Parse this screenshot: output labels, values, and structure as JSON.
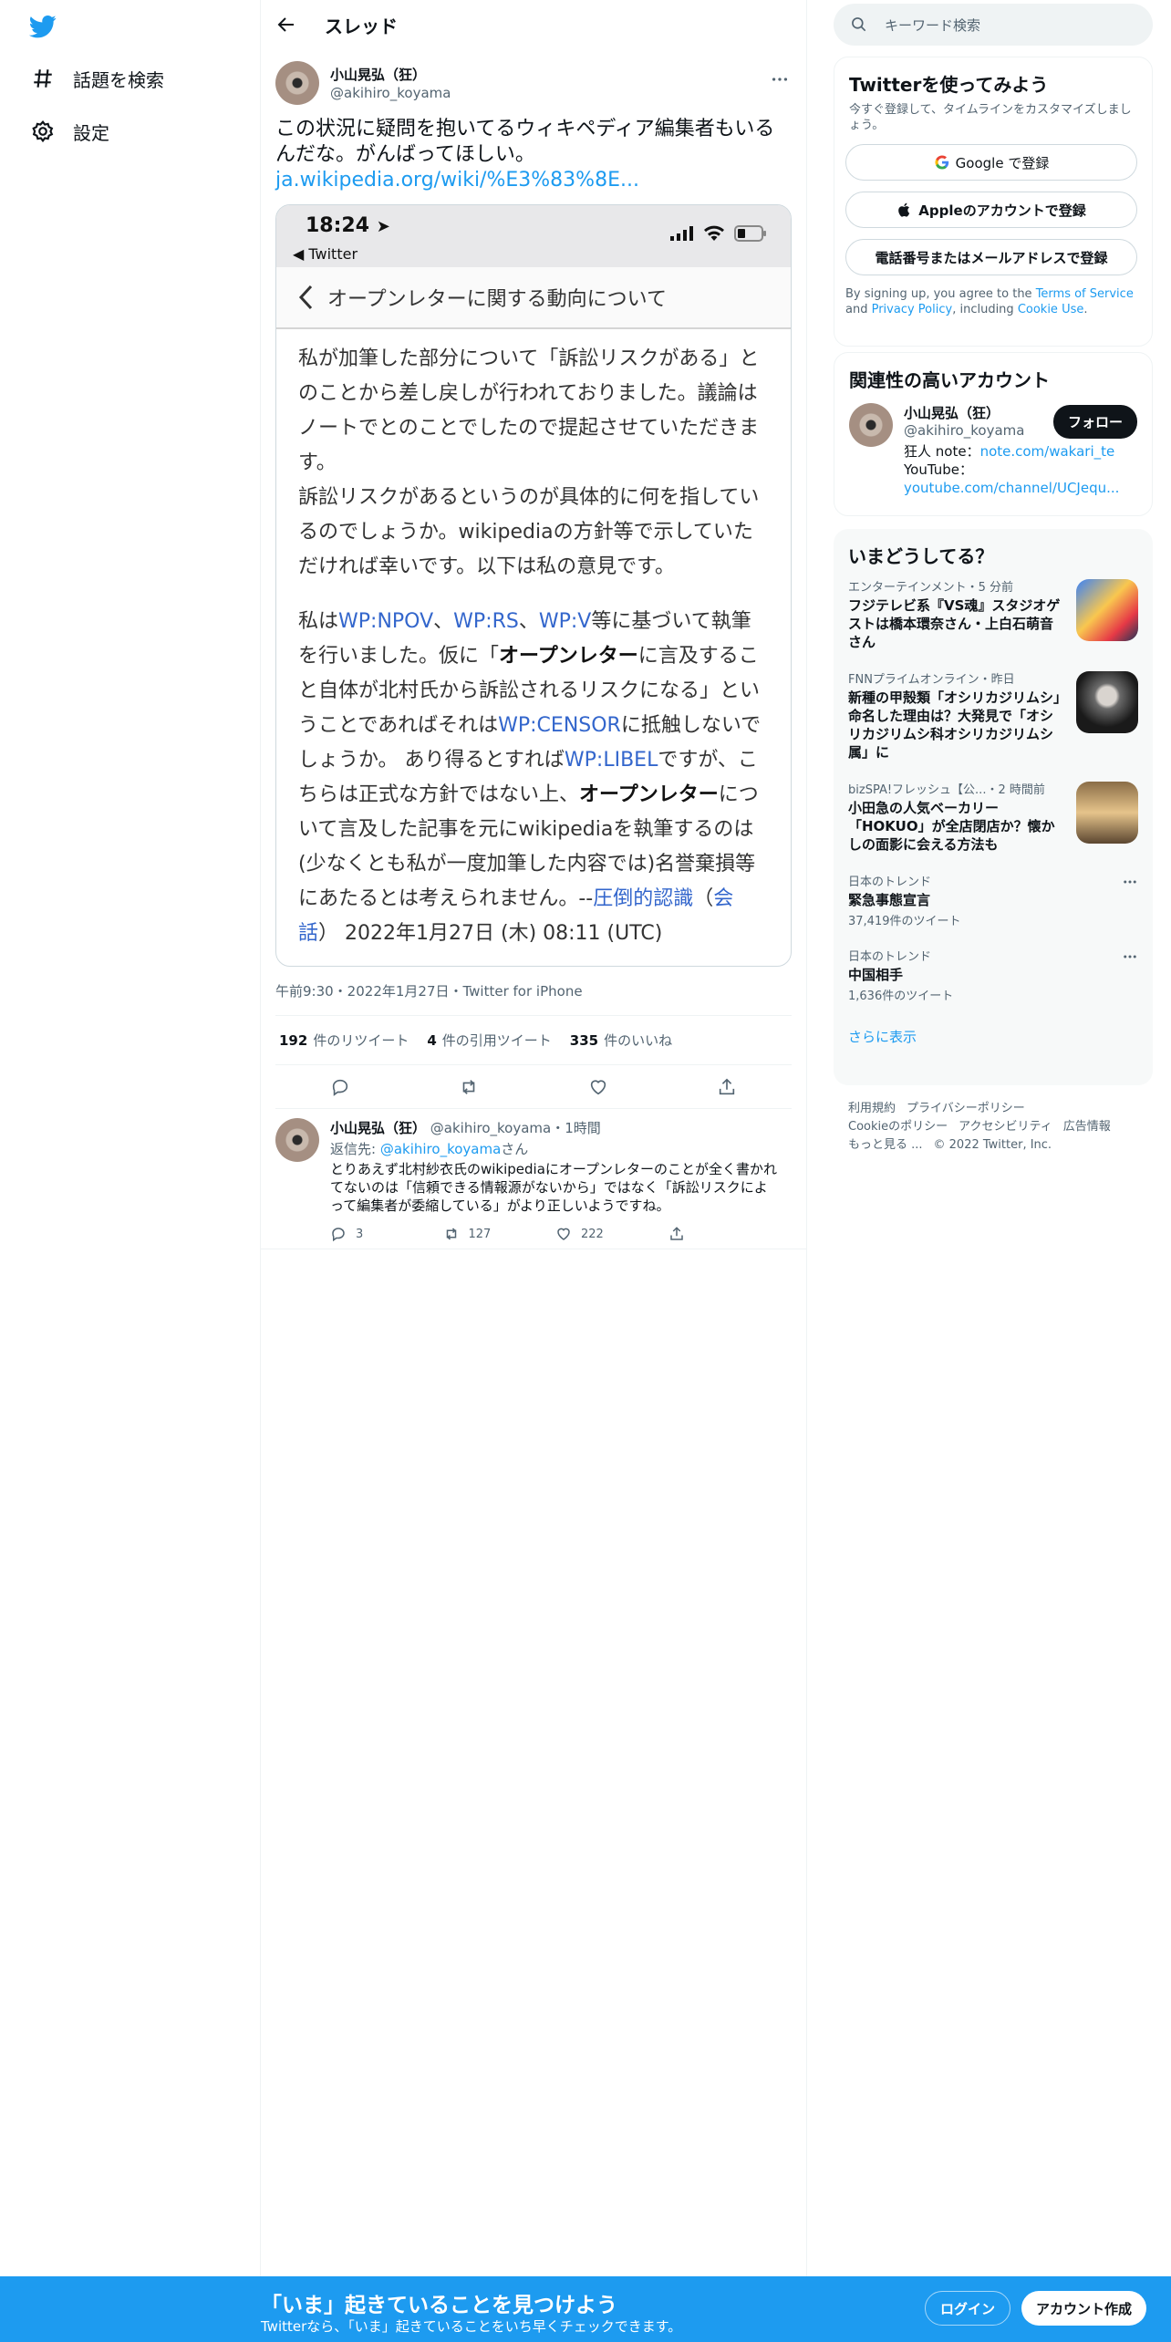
{
  "nav": {
    "explore_label": "話題を検索",
    "settings_label": "設定"
  },
  "header": {
    "title": "スレッド"
  },
  "tweet": {
    "author_name": "小山晃弘（狂）",
    "author_handle": "@akihiro_koyama",
    "text": "この状況に疑問を抱いてるウィキペディア編集者もいるんだな。がんばってほしい。",
    "link": "ja.wikipedia.org/wiki/%E3%83%8E...",
    "meta": "午前9:30・2022年1月27日・Twitter for iPhone",
    "retweets": "192",
    "retweets_label": "件のリツイート",
    "quotes": "4",
    "quotes_label": "件の引用ツイート",
    "likes": "335",
    "likes_label": "件のいいね"
  },
  "screenshot": {
    "time": "18:24",
    "back_label": "◀ Twitter",
    "nav_title": "オープンレターに関する動向について",
    "p1": "私が加筆した部分について「訴訟リスクがある」とのことから差し戻しが行われておりました。議論はノートでとのことでしたので提起させていただきます。",
    "p2": "訴訟リスクがあるというのが具体的に何を指しているのでしょうか。wikipediaの方針等で示していただければ幸いです。以下は私の意見です。",
    "p3_a": "私は",
    "p3_l1": "WP:NPOV",
    "p3_s1": "、",
    "p3_l2": "WP:RS",
    "p3_s2": "、",
    "p3_l3": "WP:V",
    "p3_b": "等に基づいて執筆を行いました。仮に「",
    "p3_bold1": "オープンレター",
    "p3_c": "に言及すること自体が北村氏から訴訟されるリスクになる」ということであればそれは",
    "p3_l4": "WP:CENSOR",
    "p3_d": "に抵触しないでしょうか。 あり得るとすれば",
    "p3_l5": "WP:LIBEL",
    "p3_e": "ですが、こちらは正式な方針ではない上、",
    "p3_bold2": "オープンレター",
    "p3_f": "について言及した記事を元にwikipediaを執筆するのは(少なくとも私が一度加筆した内容では)名誉棄損等にあたるとは考えられません。--",
    "p3_l6": "圧倒的認識",
    "p3_g": "（",
    "p3_l7": "会話",
    "p3_h": "） 2022年1月27日 (木) 08:11 (UTC)"
  },
  "reply": {
    "author_name": "小山晃弘（狂）",
    "author_handle": "@akihiro_koyama",
    "time": "・1時間",
    "reply_to_prefix": "返信先: ",
    "reply_to_handle": "@akihiro_koyama",
    "reply_to_suffix": "さん",
    "text": "とりあえず北村紗衣氏のwikipediaにオープンレターのことが全く書かれてないのは「信頼できる情報源がないから」ではなく「訴訟リスクによって編集者が委縮している」がより正しいようですね。",
    "replies": "3",
    "retweets": "127",
    "likes": "222"
  },
  "search": {
    "placeholder": "キーワード検索"
  },
  "signup": {
    "title": "Twitterを使ってみよう",
    "desc": "今すぐ登録して、タイムラインをカスタマイズしましょう。",
    "google": "Google で登録",
    "apple": "Appleのアカウントで登録",
    "phone": "電話番号またはメールアドレスで登録",
    "terms_a": "By signing up, you agree to the ",
    "terms_link1": "Terms of Service",
    "terms_b": " and ",
    "terms_link2": "Privacy Policy",
    "terms_c": ", including ",
    "terms_link3": "Cookie Use",
    "terms_d": "."
  },
  "related": {
    "title": "関連性の高いアカウント",
    "name": "小山晃弘（狂）",
    "handle": "@akihiro_koyama",
    "follow": "フォロー",
    "bio1_prefix": "狂人 note：",
    "bio1_link": "note.com/wakari_te",
    "bio2": "YouTube：",
    "bio3_link": "youtube.com/channel/UCJequ..."
  },
  "trends": {
    "title": "いまどうしてる？",
    "items": [
      {
        "meta": "エンターテインメント・5 分前",
        "title": "フジテレビ系『VS魂』スタジオゲストは橋本環奈さん・上白石萌音さん"
      },
      {
        "meta": "FNNプライムオンライン・昨日",
        "title": "新種の甲殻類「オシリカジリムシ」命名した理由は？大発見で「オシリカジリムシ科オシリカジリムシ属」に"
      },
      {
        "meta": "bizSPA!フレッシュ【公...・2 時間前",
        "title": "小田急の人気ベーカリー「HOKUO」が全店閉店か？懐かしの面影に会える方法も"
      },
      {
        "meta": "日本のトレンド",
        "title": "緊急事態宣言",
        "count": "37,419件のツイート"
      },
      {
        "meta": "日本のトレンド",
        "title": "中国相手",
        "count": "1,636件のツイート"
      }
    ],
    "show_more": "さらに表示"
  },
  "footer": {
    "terms": "利用規約",
    "privacy": "プライバシーポリシー",
    "cookie": "Cookieのポリシー",
    "accessibility": "アクセシビリティ",
    "ads": "広告情報",
    "more": "もっと見る ...",
    "copyright": "© 2022 Twitter, Inc."
  },
  "bottom_bar": {
    "title": "「いま」起きていることを見つけよう",
    "subtitle": "Twitterなら、「いま」起きていることをいち早くチェックできます。",
    "login": "ログイン",
    "signup": "アカウント作成"
  },
  "colors": {
    "accent": "#1d9bf0",
    "text": "#0f1419",
    "muted": "#536471"
  }
}
